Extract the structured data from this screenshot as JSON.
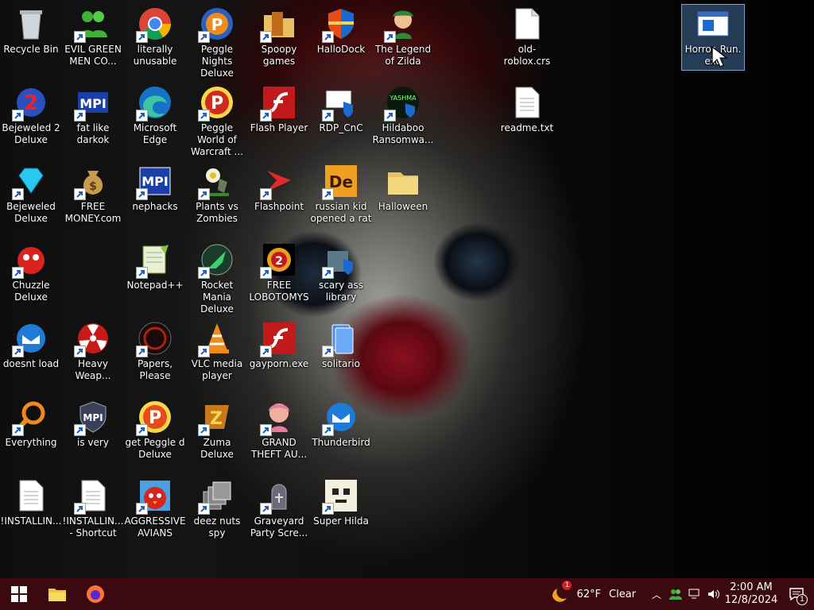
{
  "desktop": {
    "icons": [
      {
        "label": "Recycle Bin",
        "icon": "recycle-bin-icon"
      },
      {
        "label": "EVIL GREEN MEN CO...",
        "icon": "green-men-icon"
      },
      {
        "label": "literally unusable",
        "icon": "chrome-icon"
      },
      {
        "label": "Peggle Nights Deluxe",
        "icon": "peggle-nights-icon"
      },
      {
        "label": "Spoopy games",
        "icon": "folder-games-icon"
      },
      {
        "label": "HalloDock",
        "icon": "shield-icon"
      },
      {
        "label": "The Legend of Zilda",
        "icon": "zilda-icon"
      },
      {
        "label": "old-roblox.crs",
        "icon": "file-icon"
      },
      {
        "label": "Horror_Run.exe",
        "icon": "exe-window-icon"
      },
      {
        "label": "Bejeweled 2 Deluxe",
        "icon": "bejeweled2-icon"
      },
      {
        "label": "fat like darkok",
        "icon": "mpi-icon"
      },
      {
        "label": "Microsoft Edge",
        "icon": "edge-icon"
      },
      {
        "label": "Peggle World of Warcraft ...",
        "icon": "peggle-wow-icon"
      },
      {
        "label": "Flash Player",
        "icon": "flash-icon"
      },
      {
        "label": "RDP_CnC",
        "icon": "rdp-icon"
      },
      {
        "label": "Hildaboo Ransomwa...",
        "icon": "yashma-icon"
      },
      {
        "label": "readme.txt",
        "icon": "text-file-icon"
      },
      {
        "label": "Bejeweled Deluxe",
        "icon": "gem-icon"
      },
      {
        "label": "FREE MONEY.com",
        "icon": "money-bag-icon"
      },
      {
        "label": "nephacks",
        "icon": "mpi-blue-icon"
      },
      {
        "label": "Plants vs Zombies",
        "icon": "pvz-icon"
      },
      {
        "label": "Flashpoint",
        "icon": "flashpoint-icon"
      },
      {
        "label": "russian kid opened a rat",
        "icon": "de-icon"
      },
      {
        "label": "Halloween",
        "icon": "folder-icon"
      },
      {
        "label": "Chuzzle Deluxe",
        "icon": "chuzzle-icon"
      },
      {
        "label": "Notepad++",
        "icon": "notepadpp-icon"
      },
      {
        "label": "Rocket Mania Deluxe",
        "icon": "rocket-icon"
      },
      {
        "label": "FREE LOBOTOMYS",
        "icon": "lobotomy-icon"
      },
      {
        "label": "scary ass library",
        "icon": "library-icon"
      },
      {
        "label": "doesnt load",
        "icon": "thunderbird-icon"
      },
      {
        "label": "Heavy Weap...",
        "icon": "radiation-icon"
      },
      {
        "label": "Papers, Please",
        "icon": "papers-please-icon"
      },
      {
        "label": "VLC media player",
        "icon": "vlc-icon"
      },
      {
        "label": "gayporn.exe",
        "icon": "flash-icon"
      },
      {
        "label": "solitario",
        "icon": "solitaire-icon"
      },
      {
        "label": "Everything",
        "icon": "everything-search-icon"
      },
      {
        "label": "is very",
        "icon": "mpi-shield-icon"
      },
      {
        "label": "get Peggle d Deluxe",
        "icon": "peggle-icon"
      },
      {
        "label": "Zuma Deluxe",
        "icon": "zuma-icon"
      },
      {
        "label": "GRAND THEFT AU...",
        "icon": "anime-girl-icon"
      },
      {
        "label": "Thunderbird",
        "icon": "thunderbird-icon"
      },
      {
        "label": "!INSTALLIN...",
        "icon": "text-file-icon"
      },
      {
        "label": "!INSTALLIN... - Shortcut",
        "icon": "text-file-icon"
      },
      {
        "label": "AGGRESSIVE AVIANS",
        "icon": "angry-bird-icon"
      },
      {
        "label": "deez nuts spy",
        "icon": "windows-stack-icon"
      },
      {
        "label": "Graveyard Party Scre...",
        "icon": "graveyard-icon"
      },
      {
        "label": "Super Hilda",
        "icon": "pixel-dog-icon"
      }
    ]
  },
  "taskbar": {
    "weather_temp": "62°F",
    "weather_cond": "Clear",
    "weather_badge": "1",
    "time": "2:00 AM",
    "date": "12/8/2024",
    "notif_badge": "1"
  },
  "colors": {
    "taskbar": "#3a0a10",
    "accent": "#0078d7"
  }
}
